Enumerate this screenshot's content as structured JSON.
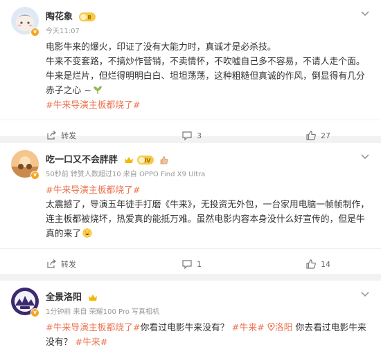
{
  "posts": [
    {
      "author": "陶花象",
      "meta": "今天11:07",
      "paragraphs": [
        "电影牛来的爆火，印证了没有大能力时，真诚才是必杀技。",
        "牛来不变套路，不搞炒作营销，不卖情怀，不吹嘘自己多不容易，不请人走个面。",
        "牛来是烂片，但烂得明明白白、坦坦荡荡，这种粗糙但真诚的作风，倒显得有几分赤子之心 ~"
      ],
      "tag": "#牛来导演主板都烧了#",
      "share_label": "转发",
      "comment_count": "3",
      "like_count": "27"
    },
    {
      "author": "吃一口又不会胖胖",
      "meta": "50秒前 转赞人数超过10 来自 OPPO Find X9 Ultra",
      "tag": "#牛来导演主板都烧了#",
      "text": "太震撼了，导演五年徒手打磨《牛来》，无投资无外包，一台家用电脑一帧帧制作，连主板都被烧坏，热爱真的能抵万难。虽然电影内容本身没什么好宣传的，但是牛真的来了",
      "share_label": "转发",
      "comment_count": "1",
      "like_count": "14"
    },
    {
      "author": "全景洛阳",
      "meta": "1分钟前 来自 荣耀100 Pro 写真相机",
      "tag1": "#牛来导演主板都烧了#",
      "text1": "你看过电影牛来没有？",
      "tag2": "#牛来#",
      "location": "洛阳",
      "text2": "你去看过电影牛来没有？",
      "tag3": "#牛来#"
    }
  ],
  "colors": {
    "accent": "#eb7350",
    "badge": "#f5a623",
    "meta": "#999999"
  }
}
